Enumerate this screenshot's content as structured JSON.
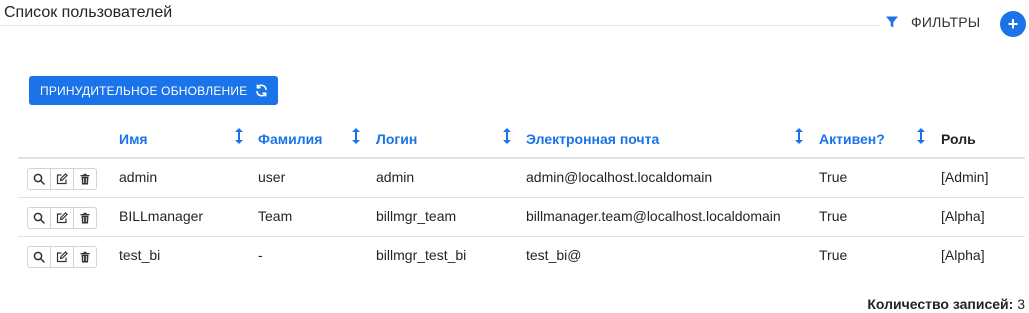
{
  "page": {
    "title": "Список пользователей",
    "filters_label": "ФИЛЬТРЫ",
    "add_icon": "+",
    "refresh_label": "ПРИНУДИТЕЛЬНОЕ ОБНОВЛЕНИЕ",
    "accent_color": "#1a73e8"
  },
  "table": {
    "columns": [
      "Имя",
      "Фамилия",
      "Логин",
      "Электронная почта",
      "Активен?",
      "Роль"
    ],
    "rows": [
      {
        "first_name": "admin",
        "last_name": "user",
        "login": "admin",
        "email": "admin@localhost.localdomain",
        "active": "True",
        "role": "[Admin]"
      },
      {
        "first_name": "BILLmanager",
        "last_name": "Team",
        "login": "billmgr_team",
        "email": "billmanager.team@localhost.localdomain",
        "active": "True",
        "role": "[Alpha]"
      },
      {
        "first_name": "test_bi",
        "last_name": "-",
        "login": "billmgr_test_bi",
        "email": "test_bi@",
        "active": "True",
        "role": "[Alpha]"
      }
    ]
  },
  "footer": {
    "count_label": "Количество записей:",
    "count_value": "3"
  },
  "icons": {
    "filter": "filter-icon",
    "add": "plus-icon",
    "refresh": "refresh-icon",
    "sort": "sort-icon",
    "view": "search-icon",
    "edit": "edit-icon",
    "delete": "trash-icon"
  }
}
